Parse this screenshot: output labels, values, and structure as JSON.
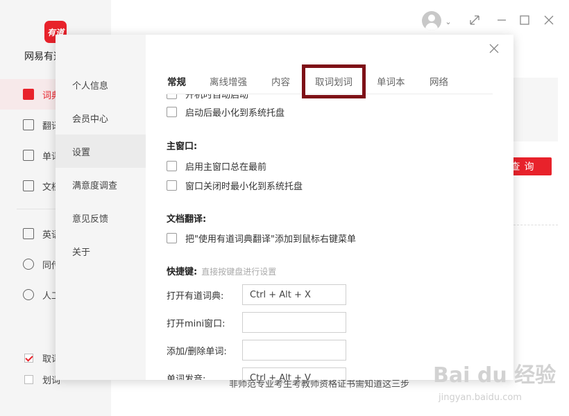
{
  "app": {
    "logo_text": "有道",
    "name": "网易有道词典",
    "nav": [
      {
        "label": "词典",
        "icon": "dictionary-icon"
      },
      {
        "label": "翻译",
        "icon": "translate-icon"
      },
      {
        "label": "单词本",
        "icon": "wordbook-icon"
      },
      {
        "label": "文档翻译",
        "icon": "document-icon"
      },
      {
        "label": "英语学习",
        "icon": "play-icon"
      },
      {
        "label": "同传",
        "icon": "cloud-icon"
      },
      {
        "label": "人工翻译",
        "icon": "headset-icon"
      }
    ],
    "bottom_checks": [
      {
        "label": "取词",
        "checked": true
      },
      {
        "label": "划词",
        "checked": false
      }
    ],
    "query_button": "查询",
    "footer_text": "非师范专业考生考教师资格证书需知道这三步"
  },
  "dialog": {
    "side": [
      "个人信息",
      "会员中心",
      "设置",
      "满意度调查",
      "意见反馈",
      "关于"
    ],
    "active_side": "设置",
    "tabs": [
      "常规",
      "离线增强",
      "内容",
      "取词划词",
      "单词本",
      "网络"
    ],
    "active_tab": "常规",
    "highlighted_tab": "取词划词",
    "partial_row": "开机时自动启动",
    "general_rows": [
      "启动后最小化到系统托盘"
    ],
    "main_window": {
      "title": "主窗口:",
      "rows": [
        "启用主窗口总在最前",
        "窗口关闭时最小化到系统托盘"
      ]
    },
    "doc_translate": {
      "title": "文档翻译:",
      "rows": [
        "把\"使用有道词典翻译\"添加到鼠标右键菜单"
      ]
    },
    "shortcuts": {
      "title": "快捷键:",
      "hint": "直接按键盘进行设置",
      "items": [
        {
          "label": "打开有道词典:",
          "value": "Ctrl + Alt + X"
        },
        {
          "label": "打开mini窗口:",
          "value": ""
        },
        {
          "label": "添加/删除单词:",
          "value": ""
        },
        {
          "label": "单词发音:",
          "value": "Ctrl + Alt + V"
        }
      ]
    }
  },
  "watermark": {
    "main": "Bai du 经验",
    "sub": "jingyan.baidu.com"
  },
  "colors": {
    "brand_red": "#e8222b",
    "highlight_border": "#7e1017"
  }
}
